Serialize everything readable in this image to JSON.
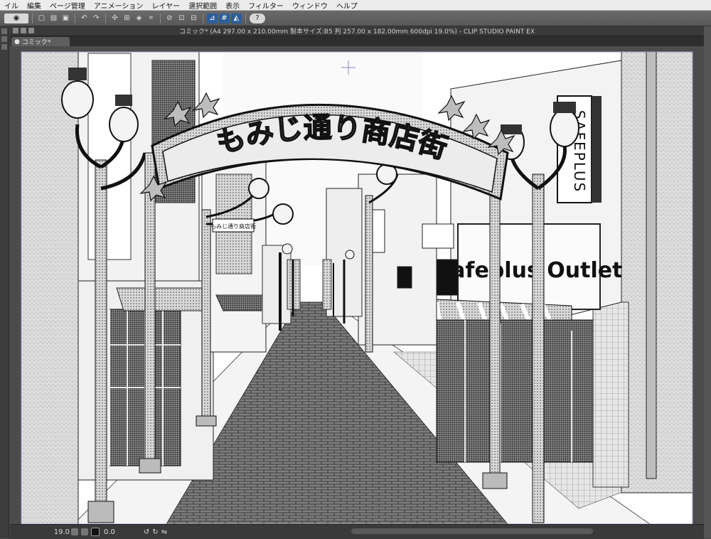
{
  "menu": [
    "イル",
    "編集",
    "ページ管理",
    "アニメーション",
    "レイヤー",
    "選択範囲",
    "表示",
    "フィルター",
    "ウィンドウ",
    "ヘルプ"
  ],
  "window": {
    "title": "コミック* (A4 297.00 x 210.00mm 製本サイズ:B5 判 257.00 x 182.00mm 600dpi 19.0%) - CLIP STUDIO PAINT EX"
  },
  "tab": {
    "label": "コミック*"
  },
  "toolbar": {
    "help_label": "?"
  },
  "status": {
    "zoom": "19.0",
    "angle": "0.0"
  },
  "artwork": {
    "arch_sign": "もみじ通り商店街",
    "vertical_sign": "SAFEPLUS",
    "outlet_sign": "Safeplus Outlet",
    "small_sign": "もみじ通り商店街"
  }
}
